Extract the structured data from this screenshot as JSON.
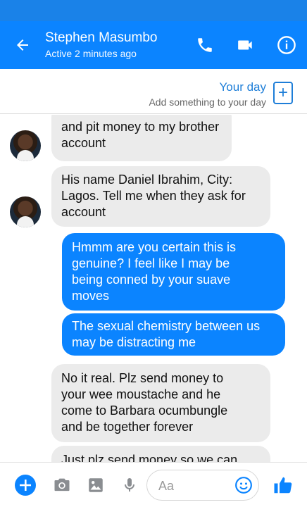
{
  "header": {
    "contact_name": "Stephen Masumbo",
    "status": "Active 2 minutes ago",
    "icons": [
      "back-arrow-icon",
      "phone-icon",
      "video-camera-icon",
      "info-icon"
    ]
  },
  "your_day": {
    "title": "Your day",
    "subtitle": "Add something to your day",
    "plus": "+"
  },
  "messages": [
    {
      "sender": "contact",
      "lines": [
        "and pit money to my brother",
        "account"
      ]
    },
    {
      "sender": "contact",
      "lines": [
        "His name Daniel Ibrahim, City:",
        "Lagos. Tell me when they ask for",
        "account"
      ]
    },
    {
      "sender": "me",
      "lines": [
        "Hmmm are you certain this is",
        "genuine? I feel like I may be",
        "being conned by your suave",
        "moves"
      ]
    },
    {
      "sender": "me",
      "lines": [
        "The sexual chemistry between us",
        "may be distracting me"
      ]
    },
    {
      "sender": "contact",
      "lines": [
        "No it real. Plz send money to",
        "your wee moustache and he",
        "come to Barbara ocumbungle",
        "and be together forever"
      ]
    },
    {
      "sender": "contact",
      "lines": [
        "Just plz send money so we can"
      ]
    }
  ],
  "composer": {
    "placeholder": "Aa",
    "icons": [
      "plus-icon",
      "camera-icon",
      "image-icon",
      "microphone-icon",
      "emoji-icon",
      "thumbs-up-icon"
    ]
  },
  "colors": {
    "header": "#0b84ff",
    "outgoing_bubble": "#0b84ff",
    "incoming_bubble": "#ebebeb",
    "accent": "#1e7ed8"
  }
}
